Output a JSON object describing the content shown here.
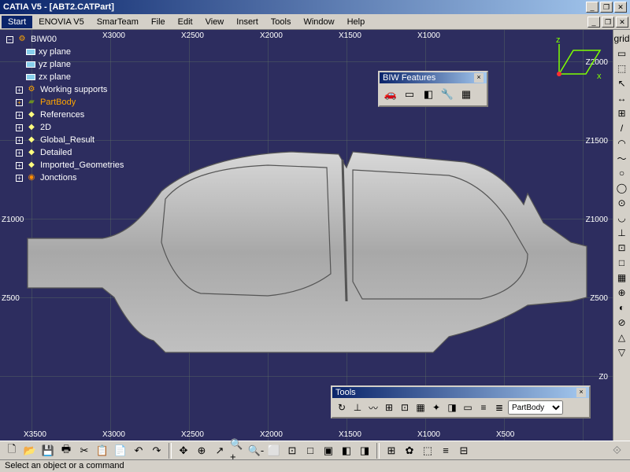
{
  "window": {
    "title": "CATIA V5 - [ABT2.CATPart]"
  },
  "menu": {
    "items": [
      "Start",
      "ENOVIA V5",
      "SmarTeam",
      "File",
      "Edit",
      "View",
      "Insert",
      "Tools",
      "Window",
      "Help"
    ]
  },
  "tree": {
    "root": "BIW00",
    "nodes": [
      {
        "label": "xy plane",
        "icon": "plane"
      },
      {
        "label": "yz plane",
        "icon": "plane"
      },
      {
        "label": "zx plane",
        "icon": "plane"
      },
      {
        "label": "Working supports",
        "icon": "gear",
        "expandable": true
      },
      {
        "label": "PartBody",
        "icon": "body",
        "expandable": true,
        "selected": true
      },
      {
        "label": "References",
        "icon": "ref",
        "expandable": true
      },
      {
        "label": "2D",
        "icon": "ref",
        "expandable": true
      },
      {
        "label": "Global_Result",
        "icon": "ref",
        "expandable": true
      },
      {
        "label": "Detailed",
        "icon": "ref",
        "expandable": true
      },
      {
        "label": "Imported_Geometries",
        "icon": "ref",
        "expandable": true
      },
      {
        "label": "Jonctions",
        "icon": "dot",
        "expandable": true
      }
    ]
  },
  "ruler": {
    "x": [
      "X3500",
      "X3000",
      "X2500",
      "X2000",
      "X1500",
      "X1000",
      "X500"
    ],
    "z": [
      "Z2000",
      "Z1500",
      "Z1000",
      "Z500",
      "Z0"
    ]
  },
  "panels": {
    "biw": {
      "title": "BIW Features"
    },
    "tools": {
      "title": "Tools",
      "selected": "PartBody"
    }
  },
  "status": {
    "text": "Select an object or a command"
  },
  "icons": {
    "right": [
      "grid",
      "▭",
      "⬚",
      "↖",
      "↔",
      "⊞",
      "/",
      "◠",
      "～",
      "○",
      "◯",
      "⊙",
      "◡",
      "⊥",
      "⊡",
      "□",
      "▦",
      "⊕",
      "◐",
      "⊘",
      "△",
      "▽"
    ],
    "bottom_file": [
      "🗋",
      "📂",
      "💾",
      "🖶",
      "✂",
      "📋",
      "📄",
      "↶",
      "↷"
    ],
    "bottom_view": [
      "✥",
      "⊕",
      "↗",
      "🔍+",
      "🔍-",
      "⬜",
      "⊡",
      "□",
      "▣",
      "◧",
      "◨"
    ],
    "bottom_misc": [
      "⊞",
      "✿",
      "⬚",
      "≡",
      "⊟"
    ],
    "biw": [
      "🚗",
      "▭",
      "◧",
      "🔧",
      "▦"
    ],
    "tools": [
      "↻",
      "⊥",
      "〰",
      "⊞",
      "⊡",
      "▦",
      "✦",
      "◨",
      "▭",
      "≡",
      "≣"
    ]
  }
}
